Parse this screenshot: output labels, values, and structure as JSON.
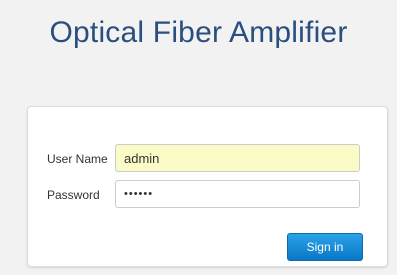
{
  "header": {
    "title": "Optical Fiber Amplifier"
  },
  "login": {
    "username_label": "User Name",
    "username_value": "admin",
    "password_label": "Password",
    "password_value": "••••••",
    "signin_label": "Sign in"
  },
  "colors": {
    "title": "#2a4f7e",
    "page_background": "#f2f2f2",
    "username_field_background": "#fbfbc8",
    "signin_button": "#1a8ad6"
  }
}
